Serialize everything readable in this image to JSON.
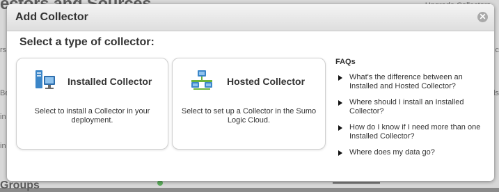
{
  "backdrop": {
    "title_fragment": "ectors and Sources",
    "bottom_fragment": "Groups",
    "top_right_fragment": "Upgrade Collectors",
    "left_fragments": [
      "rs",
      "Be",
      "in",
      "in"
    ],
    "right_fragments": [
      "c",
      "ds"
    ]
  },
  "dialog": {
    "title": "Add Collector",
    "close_glyph": "✕",
    "subtitle": "Select a type of collector:"
  },
  "cards": [
    {
      "title": "Installed Collector",
      "description": "Select to install a Collector in your deployment.",
      "icon": "server-computer-icon"
    },
    {
      "title": "Hosted Collector",
      "description": "Select to set up a Collector in the Sumo Logic Cloud.",
      "icon": "network-hosted-icon"
    }
  ],
  "faqs": {
    "title": "FAQs",
    "items": [
      "What's the difference between an Installed and Hosted Collector?",
      "Where should I install an Installed Collector?",
      "How do I know if I need more than one Installed Collector?",
      "Where does my data go?"
    ]
  },
  "colors": {
    "overlay": "#8a8a8a",
    "header_gradient_top": "#f4f4f4",
    "header_gradient_bottom": "#dedede",
    "icon_blue": "#3b86c8",
    "icon_green": "#6cb33e"
  }
}
